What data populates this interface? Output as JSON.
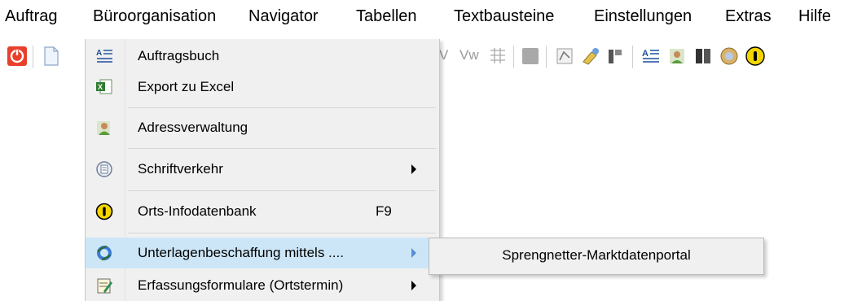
{
  "menubar": {
    "items": [
      {
        "label": "Auftrag"
      },
      {
        "label": "Büroorganisation"
      },
      {
        "label": "Navigator"
      },
      {
        "label": "Tabellen"
      },
      {
        "label": "Textbausteine"
      },
      {
        "label": "Einstellungen"
      },
      {
        "label": "Extras"
      },
      {
        "label": "Hilfe"
      }
    ]
  },
  "toolbar": {
    "faint_labels": [
      "V",
      "Vw"
    ]
  },
  "dropdown": {
    "items": [
      {
        "label": "Auftragsbuch",
        "icon": "text-lines-icon"
      },
      {
        "label": "Export zu Excel",
        "icon": "excel-icon"
      },
      {
        "label": "Adressverwaltung",
        "icon": "address-book-icon"
      },
      {
        "label": "Schriftverkehr",
        "icon": "correspondence-icon",
        "has_submenu": true
      },
      {
        "label": "Orts-Infodatenbank",
        "icon": "info-icon",
        "shortcut": "F9"
      },
      {
        "label": "Unterlagenbeschaffung mittels ....",
        "icon": "globe-icon",
        "has_submenu": true,
        "highlighted": true
      },
      {
        "label": "Erfassungsformulare (Ortstermin)",
        "icon": "form-icon",
        "has_submenu": true
      }
    ]
  },
  "submenu": {
    "items": [
      {
        "label": "Sprengnetter-Marktdatenportal"
      }
    ]
  },
  "colors": {
    "highlight": "#cde6f7",
    "menu_bg": "#f0f0f0",
    "power_red": "#e8402a",
    "info_yellow": "#f3d500"
  }
}
